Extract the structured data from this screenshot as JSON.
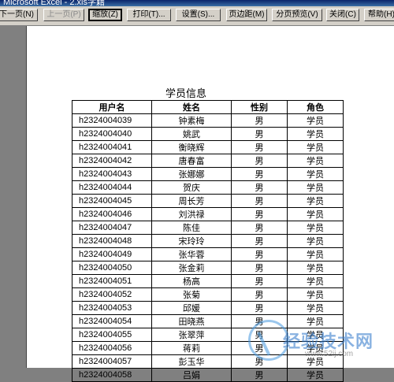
{
  "window": {
    "title": "Microsoft Excel - 2.xls学籍"
  },
  "toolbar": {
    "buttons": [
      {
        "label": "下一页(N)"
      },
      {
        "label": "上一页(P)"
      },
      {
        "label": "缩放(Z)"
      },
      {
        "label": "打印(T)..."
      },
      {
        "label": "设置(S)..."
      },
      {
        "label": "页边距(M)"
      },
      {
        "label": "分页预览(V)"
      },
      {
        "label": "关闭(C)"
      },
      {
        "label": "帮助(H)"
      }
    ]
  },
  "sheet": {
    "title": "学员信息",
    "headers": [
      "用户名",
      "姓名",
      "性别",
      "角色"
    ],
    "rows": [
      [
        "h2324004039",
        "钟素梅",
        "男",
        "学员"
      ],
      [
        "h2324004040",
        "姚武",
        "男",
        "学员"
      ],
      [
        "h2324004041",
        "衡晓辉",
        "男",
        "学员"
      ],
      [
        "h2324004042",
        "唐春富",
        "男",
        "学员"
      ],
      [
        "h2324004043",
        "张娜娜",
        "男",
        "学员"
      ],
      [
        "h2324004044",
        "贺庆",
        "男",
        "学员"
      ],
      [
        "h2324004045",
        "周长芳",
        "男",
        "学员"
      ],
      [
        "h2324004046",
        "刘洪禄",
        "男",
        "学员"
      ],
      [
        "h2324004047",
        "陈佳",
        "男",
        "学员"
      ],
      [
        "h2324004048",
        "宋玲玲",
        "男",
        "学员"
      ],
      [
        "h2324004049",
        "张华蓉",
        "男",
        "学员"
      ],
      [
        "h2324004050",
        "张金莉",
        "男",
        "学员"
      ],
      [
        "h2324004051",
        "杨高",
        "男",
        "学员"
      ],
      [
        "h2324004052",
        "张菊",
        "男",
        "学员"
      ],
      [
        "h2324004053",
        "邱媛",
        "男",
        "学员"
      ],
      [
        "h2324004054",
        "田晓燕",
        "男",
        "学员"
      ],
      [
        "h2324004055",
        "张翠萍",
        "男",
        "学员"
      ],
      [
        "h2324004056",
        "蒋莉",
        "男",
        "学员"
      ],
      [
        "h2324004057",
        "彭玉华",
        "男",
        "学员"
      ],
      [
        "h2324004058",
        "吕娟",
        "男",
        "学员"
      ]
    ]
  },
  "watermark": {
    "text": "经验技术网",
    "url": "www.52ij.com"
  }
}
